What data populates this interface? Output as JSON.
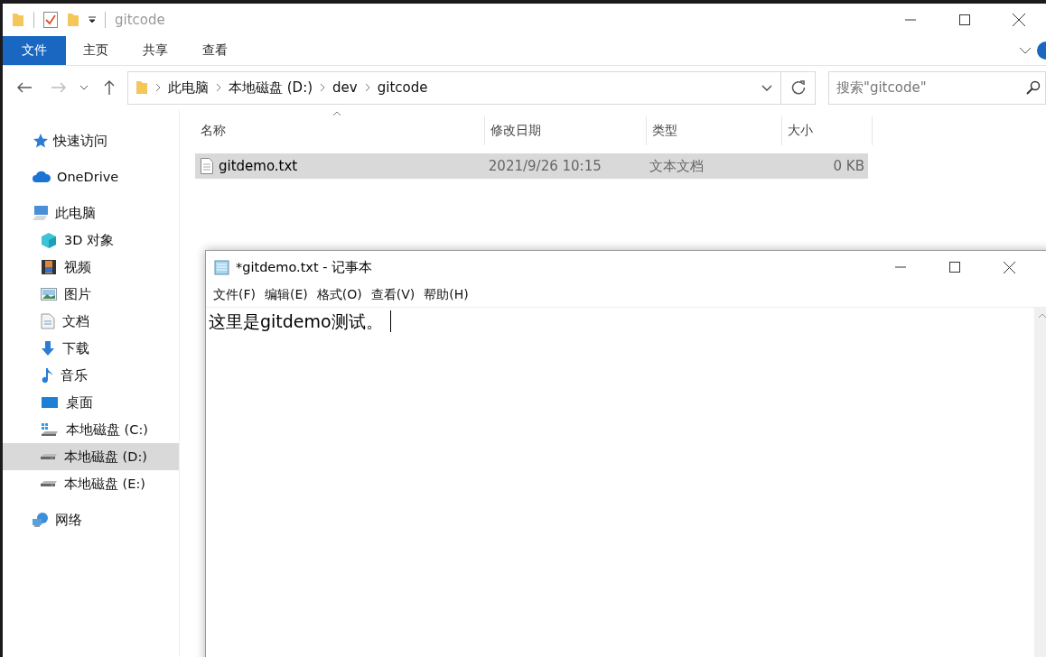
{
  "explorer": {
    "title": "gitcode",
    "ribbon_tabs": [
      {
        "label": "文件",
        "selected": true
      },
      {
        "label": "主页",
        "selected": false
      },
      {
        "label": "共享",
        "selected": false
      },
      {
        "label": "查看",
        "selected": false
      }
    ],
    "address": {
      "crumbs": [
        "此电脑",
        "本地磁盘 (D:)",
        "dev",
        "gitcode"
      ]
    },
    "search": {
      "placeholder": "搜索\"gitcode\""
    },
    "sidebar": {
      "items": [
        {
          "label": "快速访问",
          "kind": "star",
          "selected": false
        },
        {
          "label": "OneDrive",
          "kind": "cloud",
          "selected": false
        },
        {
          "label": "此电脑",
          "kind": "computer",
          "selected": false,
          "children": [
            {
              "label": "3D 对象",
              "kind": "cube",
              "selected": false
            },
            {
              "label": "视频",
              "kind": "film",
              "selected": false
            },
            {
              "label": "图片",
              "kind": "image",
              "selected": false
            },
            {
              "label": "文档",
              "kind": "document",
              "selected": false
            },
            {
              "label": "下载",
              "kind": "download",
              "selected": false
            },
            {
              "label": "音乐",
              "kind": "music",
              "selected": false
            },
            {
              "label": "桌面",
              "kind": "desktop",
              "selected": false
            },
            {
              "label": "本地磁盘 (C:)",
              "kind": "system-drive",
              "selected": false
            },
            {
              "label": "本地磁盘 (D:)",
              "kind": "drive",
              "selected": true
            },
            {
              "label": "本地磁盘 (E:)",
              "kind": "drive",
              "selected": false
            }
          ]
        },
        {
          "label": "网络",
          "kind": "network",
          "selected": false
        }
      ]
    },
    "file_list": {
      "columns": [
        "名称",
        "修改日期",
        "类型",
        "大小"
      ],
      "rows": [
        {
          "name": "gitdemo.txt",
          "modified": "2021/9/26 10:15",
          "type": "文本文档",
          "size": "0 KB",
          "selected": true
        }
      ]
    }
  },
  "notepad": {
    "title": "*gitdemo.txt - 记事本",
    "menu": [
      "文件(F)",
      "编辑(E)",
      "格式(O)",
      "查看(V)",
      "帮助(H)"
    ],
    "text": "这里是gitdemo测试。"
  }
}
